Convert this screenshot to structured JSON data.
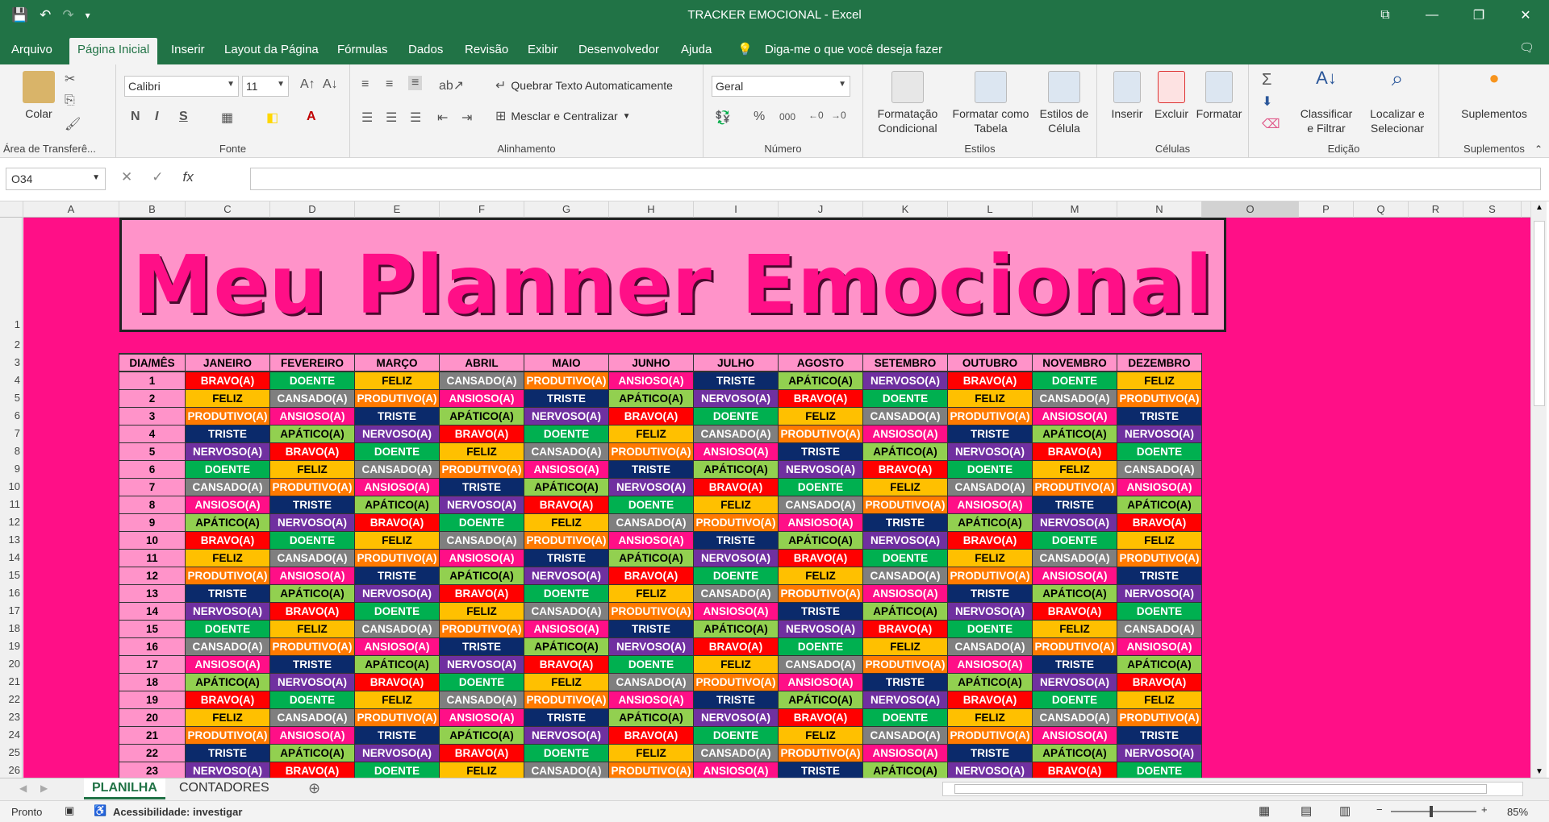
{
  "app": {
    "title": "TRACKER EMOCIONAL  -  Excel",
    "tabs": [
      "Arquivo",
      "Página Inicial",
      "Inserir",
      "Layout da Página",
      "Fórmulas",
      "Dados",
      "Revisão",
      "Exibir",
      "Desenvolvedor",
      "Ajuda"
    ],
    "tell_me": "Diga-me o que você deseja fazer"
  },
  "ribbon": {
    "clipboard": {
      "paste": "Colar",
      "label": "Área de Transferê..."
    },
    "font": {
      "name": "Calibri",
      "size": "11",
      "bold": "N",
      "italic": "I",
      "underline": "S",
      "label": "Fonte"
    },
    "alignment": {
      "wrap": "Quebrar Texto Automaticamente",
      "merge": "Mesclar e Centralizar",
      "label": "Alinhamento"
    },
    "number": {
      "format": "Geral",
      "percent": "%",
      "thousands": "000",
      "label": "Número"
    },
    "styles": {
      "conditional": "Formatação Condicional",
      "table": "Formatar como Tabela",
      "cell": "Estilos de Célula",
      "label": "Estilos"
    },
    "cells": {
      "insert": "Inserir",
      "delete": "Excluir",
      "format": "Formatar",
      "label": "Células"
    },
    "editing": {
      "sort": "Classificar e Filtrar",
      "find": "Localizar e Selecionar",
      "label": "Edição"
    },
    "addins": {
      "button": "Suplementos",
      "label": "Suplementos"
    }
  },
  "formula_bar": {
    "name_box": "O34",
    "fx": "fx",
    "value": ""
  },
  "columns": [
    "A",
    "B",
    "C",
    "D",
    "E",
    "F",
    "G",
    "H",
    "I",
    "J",
    "K",
    "L",
    "M",
    "N",
    "O",
    "P",
    "Q",
    "R",
    "S"
  ],
  "row_numbers": [
    "1",
    "2",
    "3",
    "4",
    "5",
    "6",
    "7",
    "8",
    "9",
    "10",
    "11",
    "12",
    "13",
    "14",
    "15",
    "16",
    "17",
    "18",
    "19",
    "20",
    "21",
    "22",
    "23",
    "24",
    "25",
    "26"
  ],
  "sheet": {
    "banner_title": "Meu Planner Emocional",
    "header": [
      "DIA/MÊS",
      "JANEIRO",
      "FEVEREIRO",
      "MARÇO",
      "ABRIL",
      "MAIO",
      "JUNHO",
      "JULHO",
      "AGOSTO",
      "SETEMBRO",
      "OUTUBRO",
      "NOVEMBRO",
      "DEZEMBRO"
    ],
    "days": [
      "1",
      "2",
      "3",
      "4",
      "5",
      "6",
      "7",
      "8",
      "9",
      "10",
      "11",
      "12",
      "13",
      "14",
      "15",
      "16",
      "17",
      "18",
      "19",
      "20",
      "21",
      "22",
      "23"
    ],
    "cycle": [
      "BRAVO(A)",
      "FELIZ",
      "PRODUTIVO(A)",
      "TRISTE",
      "NERVOSO(A)",
      "DOENTE",
      "CANSADO(A)",
      "ANSIOSO(A)",
      "APÁTICO(A)"
    ],
    "emotion_colors": {
      "BRAVO(A)": {
        "bg": "#ff0000",
        "fg": "#ffffff"
      },
      "FELIZ": {
        "bg": "#ffc000",
        "fg": "#000000"
      },
      "PRODUTIVO(A)": {
        "bg": "#ff7a00",
        "fg": "#ffffff"
      },
      "TRISTE": {
        "bg": "#0b2a6b",
        "fg": "#ffffff"
      },
      "NERVOSO(A)": {
        "bg": "#7030a0",
        "fg": "#ffffff"
      },
      "DOENTE": {
        "bg": "#00b050",
        "fg": "#ffffff"
      },
      "CANSADO(A)": {
        "bg": "#7f7f7f",
        "fg": "#ffffff"
      },
      "ANSIOSO(A)": {
        "bg": "#ff0f87",
        "fg": "#ffffff"
      },
      "APÁTICO(A)": {
        "bg": "#92d050",
        "fg": "#000000"
      }
    }
  },
  "sheet_tabs": [
    "PLANILHA",
    "CONTADORES"
  ],
  "status": {
    "ready": "Pronto",
    "accessibility": "Acessibilidade: investigar",
    "zoom": "85%"
  }
}
